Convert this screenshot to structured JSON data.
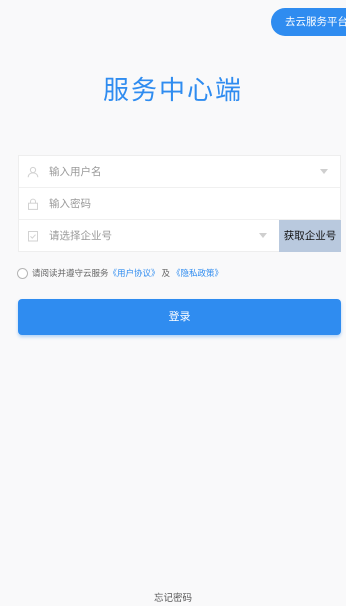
{
  "header": {
    "cloud_platform_label": "去云服务平台"
  },
  "title": "服务中心端",
  "form": {
    "username_placeholder": "输入用户名",
    "password_placeholder": "输入密码",
    "company_placeholder": "请选择企业号",
    "get_company_label": "获取企业号"
  },
  "agreement": {
    "prefix": "请阅读并遵守云服务",
    "user_agreement": "《用户协议》",
    "and": "及",
    "privacy_policy": "《隐私政策》"
  },
  "login_label": "登录",
  "forgot_password_label": "忘记密码",
  "colors": {
    "accent": "#2f8cf0",
    "get_code_bg": "#b9c9de"
  }
}
